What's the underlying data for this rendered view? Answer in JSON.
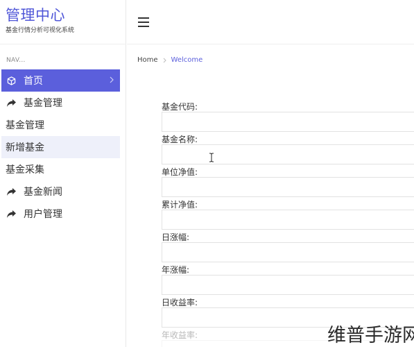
{
  "brand": {
    "title": "管理中心",
    "subtitle": "基金行情分析可视化系统"
  },
  "sidebar": {
    "heading": "NAV...",
    "items": [
      {
        "label": "首页",
        "icon": "cube-icon",
        "state": "active"
      },
      {
        "label": "基金管理",
        "icon": "share-arrow-icon"
      },
      {
        "label": "基金管理"
      },
      {
        "label": "新增基金",
        "state": "highlighted"
      },
      {
        "label": "基金采集"
      },
      {
        "label": "基金新闻",
        "icon": "share-arrow-icon"
      },
      {
        "label": "用户管理",
        "icon": "share-arrow-icon"
      }
    ]
  },
  "topbar": {
    "menu_icon": "hamburger-icon"
  },
  "breadcrumb": {
    "home": "Home",
    "current": "Welcome"
  },
  "form": {
    "fields": [
      {
        "label": "基金代码:",
        "value": ""
      },
      {
        "label": "基金名称:",
        "value": ""
      },
      {
        "label": "单位净值:",
        "value": ""
      },
      {
        "label": "累计净值:",
        "value": ""
      },
      {
        "label": "日涨幅:",
        "value": ""
      },
      {
        "label": "年涨幅:",
        "value": ""
      },
      {
        "label": "日收益率:",
        "value": ""
      },
      {
        "label": "年收益率:",
        "value": ""
      }
    ]
  },
  "watermark": "维普手游网",
  "colors": {
    "accent": "#5b5fdc",
    "highlight": "#eef0fa",
    "brand": "#4f56d8"
  }
}
